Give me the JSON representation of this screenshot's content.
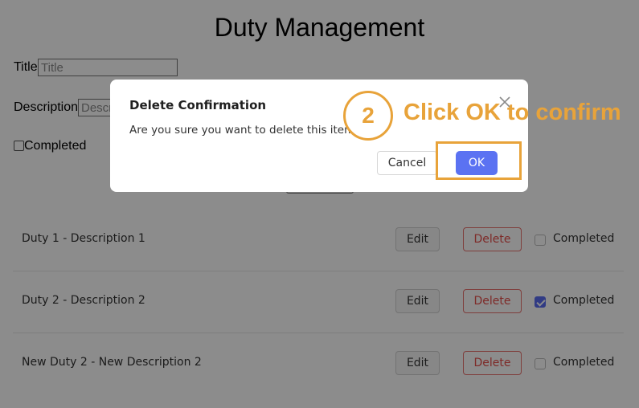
{
  "page": {
    "title": "Duty Management"
  },
  "form": {
    "title_label": "Title",
    "title_placeholder": "Title",
    "description_label": "Description",
    "description_placeholder": "Description",
    "completed_label": "Completed"
  },
  "duties": [
    {
      "text": "Duty 1 - Description 1",
      "edit_label": "Edit",
      "delete_label": "Delete",
      "completed": false,
      "completed_label": "Completed"
    },
    {
      "text": "Duty 2 - Description 2",
      "edit_label": "Edit",
      "delete_label": "Delete",
      "completed": true,
      "completed_label": "Completed"
    },
    {
      "text": "New Duty 2 - New Description 2",
      "edit_label": "Edit",
      "delete_label": "Delete",
      "completed": false,
      "completed_label": "Completed"
    }
  ],
  "modal": {
    "title": "Delete Confirmation",
    "body": "Are you sure you want to delete this item?",
    "cancel_label": "Cancel",
    "ok_label": "OK"
  },
  "annotation": {
    "step": "2",
    "text": "Click OK to confirm"
  },
  "colors": {
    "accent": "#5b72f2",
    "danger": "#e54d4a",
    "annotation": "#e8a33a"
  }
}
